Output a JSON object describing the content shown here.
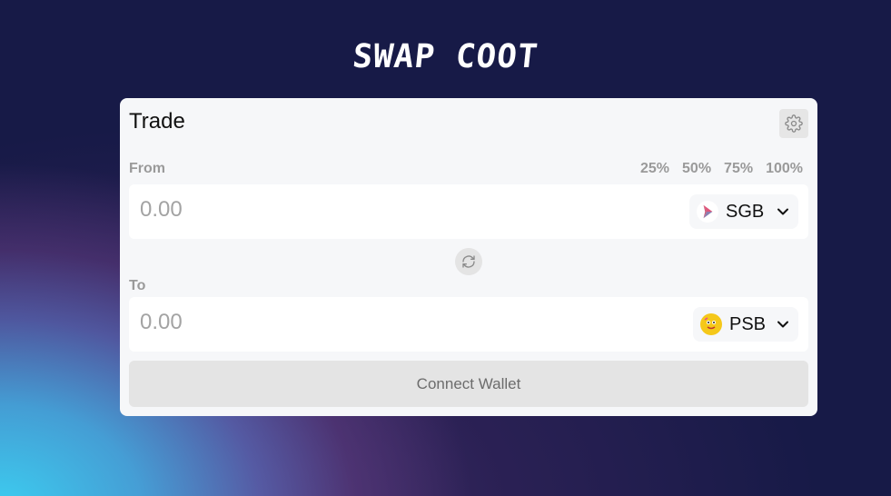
{
  "brand": {
    "name": "SWAP COOT"
  },
  "trade": {
    "title": "Trade",
    "settings_icon": "gear-icon",
    "from": {
      "label": "From",
      "percentages": [
        "25%",
        "50%",
        "75%",
        "100%"
      ],
      "placeholder": "0.00",
      "token": {
        "symbol": "SGB",
        "icon": "songbird-icon"
      }
    },
    "switch_icon": "refresh-icon",
    "to": {
      "label": "To",
      "placeholder": "0.00",
      "token": {
        "symbol": "PSB",
        "icon": "psb-icon"
      }
    },
    "connect_label": "Connect Wallet"
  },
  "colors": {
    "background": "#171a47",
    "card": "#f6f7f9",
    "muted_text": "#9a9a9a",
    "button_gray": "#e4e4e4"
  }
}
